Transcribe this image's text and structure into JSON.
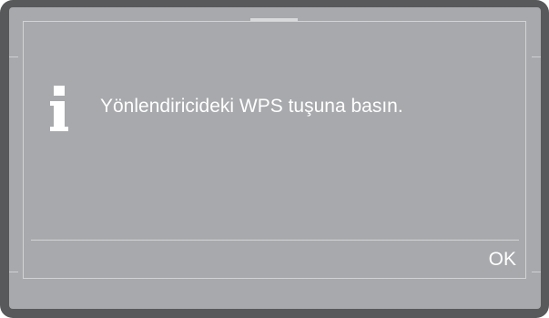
{
  "dialog": {
    "message": "Yönlendiricideki WPS tuşuna basın.",
    "icon": "info-icon",
    "ok_label": "OK"
  },
  "colors": {
    "bezel": "#58595b",
    "screen": "#a7a9ac",
    "text": "#ffffff",
    "border": "#d1d3d4"
  }
}
